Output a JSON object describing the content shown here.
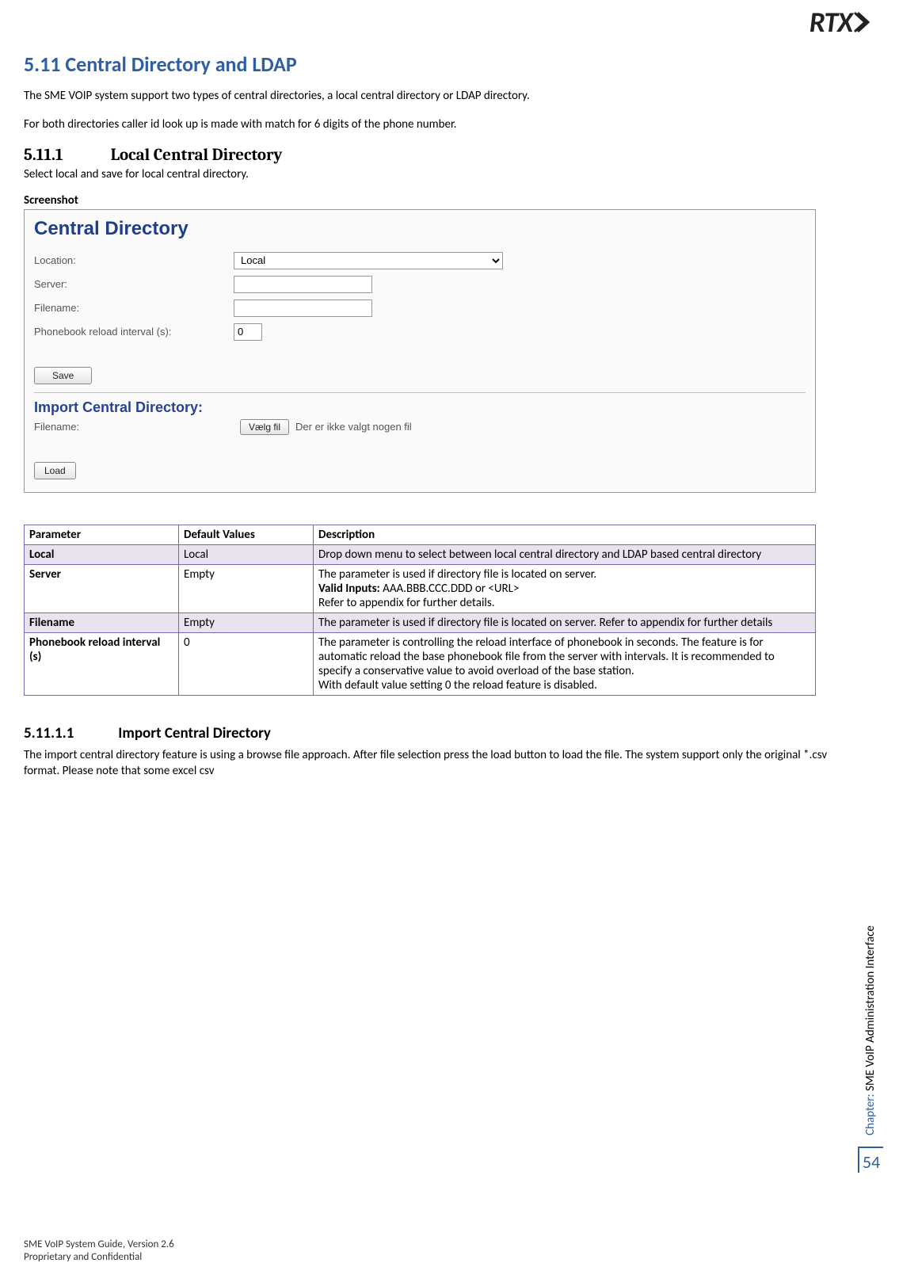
{
  "logo": "RTX",
  "section": {
    "num": "5.11",
    "title": "Central Directory and LDAP"
  },
  "intro_p1": "The SME VOIP system support two types of central directories, a local central directory or LDAP directory.",
  "intro_p2": "For both directories caller id look up is made with match for 6 digits of the phone number.",
  "sub1": {
    "num": "5.11.1",
    "title": "Local Central Directory",
    "text": "Select local and save for local central directory."
  },
  "screenshot_label": "Screenshot",
  "screenshot": {
    "title": "Central Directory",
    "location_label": "Location:",
    "location_value": "Local",
    "server_label": "Server:",
    "server_value": "",
    "filename_label": "Filename:",
    "filename_value": "",
    "reload_label": "Phonebook reload interval (s):",
    "reload_value": "0",
    "save_btn": "Save",
    "import_title": "Import Central Directory:",
    "import_filename_label": "Filename:",
    "file_btn": "Vælg fil",
    "file_text": "Der er ikke valgt nogen fil",
    "load_btn": "Load"
  },
  "table": {
    "headers": {
      "param": "Parameter",
      "def": "Default Values",
      "desc": "Description"
    },
    "rows": [
      {
        "param": "Local",
        "def": "Local",
        "desc": "Drop down menu to select between local central directory and LDAP based central directory"
      },
      {
        "param": "Server",
        "def": "Empty",
        "desc": "The parameter is used if directory file is located on server.\nValid Inputs: AAA.BBB.CCC.DDD or <URL>\nRefer to appendix for further details."
      },
      {
        "param": "Filename",
        "def": "Empty",
        "desc": "The parameter is used if directory file is located on server. Refer to appendix for further details"
      },
      {
        "param": "Phonebook reload interval (s)",
        "def": "0",
        "desc": "The parameter is controlling the reload interface of phonebook in seconds. The feature is for automatic reload the base phonebook file from the server with intervals. It is recommended to specify a conservative value to avoid overload of the base station.\nWith default value setting 0 the reload feature is disabled."
      }
    ]
  },
  "sub2": {
    "num": "5.11.1.1",
    "title": "Import Central Directory",
    "text": "The import central directory feature is using a browse file approach. After file selection press the load button to load the file. The system support only the original *.csv format. Please note that some excel csv"
  },
  "sidebar": {
    "chapter_label": "Chapter:",
    "chapter_text": "SME VoIP Administration Interface",
    "page": "54"
  },
  "footer": {
    "line1": "SME VoIP System Guide, Version 2.6",
    "line2": "Proprietary and Confidential"
  }
}
